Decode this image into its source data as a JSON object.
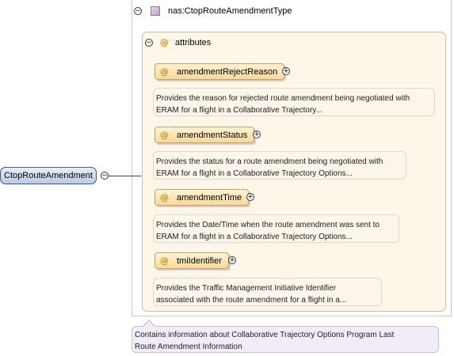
{
  "root": {
    "label": "CtopRouteAmendment"
  },
  "type": {
    "name": "nas:CtopRouteAmendmentType",
    "icon": "complex-type-icon"
  },
  "attributes_group": {
    "label": "attributes"
  },
  "attributes": [
    {
      "name": "amendmentRejectReason",
      "doc_line1": "Provides the reason for rejected route amendment being negotiated with",
      "doc_line2": "ERAM for a flight in a Collaborative Trajectory..."
    },
    {
      "name": "amendmentStatus",
      "doc_line1": "Provides the status for a route amendment being negotiated with",
      "doc_line2": "ERAM for a flight in a Collaborative Trajectory Options..."
    },
    {
      "name": "amendmentTime",
      "doc_line1": "Provides the Date/Time when the route amendment was sent to",
      "doc_line2": "ERAM for a flight in a Collaborative Trajectory Options..."
    },
    {
      "name": "tmiIdentifier",
      "doc_line1": "Provides the Traffic Management Initiative Identifier",
      "doc_line2": "associated with the route amendment for a flight in a..."
    }
  ],
  "root_doc": {
    "line1": "Contains information about Collaborative Trajectory Options Program Last",
    "line2": "Route Amendment Information"
  },
  "symbols": {
    "collapse": "−",
    "expand": "+",
    "attribute": "@"
  },
  "colors": {
    "root_fill": "#b9cbe3",
    "attribute_fill": "#f7d99a",
    "group_fill": "#fdf6e9",
    "type_icon": "#b9a1cc"
  }
}
